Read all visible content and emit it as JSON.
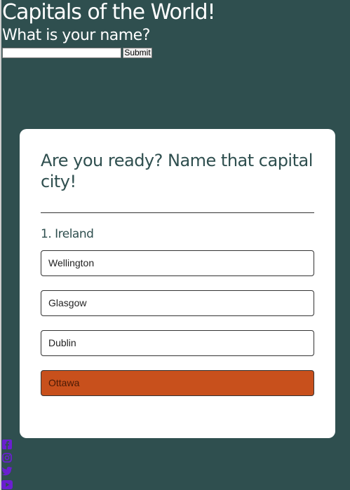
{
  "header": {
    "title": "Capitals of the World!",
    "name_prompt": "What is your name?",
    "name_input_value": "",
    "submit_label": "Submit"
  },
  "quiz": {
    "heading": "Are you ready? Name that capital city!",
    "question": "1. Ireland",
    "answers": [
      {
        "label": "Wellington",
        "state": "default"
      },
      {
        "label": "Glasgow",
        "state": "default"
      },
      {
        "label": "Dublin",
        "state": "default"
      },
      {
        "label": "Ottawa",
        "state": "wrong"
      }
    ]
  },
  "social": [
    "facebook-icon",
    "instagram-icon",
    "twitter-icon",
    "youtube-icon"
  ],
  "colors": {
    "background": "#2f4f4f",
    "card": "#ffffff",
    "wrong_answer": "#c8501c",
    "social_icons": "#6a1fd0"
  }
}
